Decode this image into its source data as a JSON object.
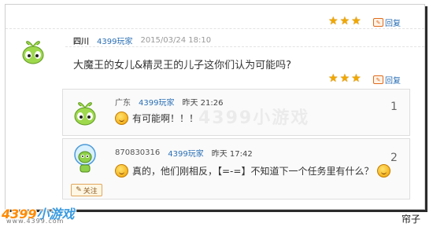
{
  "post": {
    "user": "四川",
    "source": "4399玩家",
    "time": "2015/03/24 18:10",
    "content": "大魔王的女儿&精灵王的儿子这你们认为可能吗?",
    "reply_label": "回复"
  },
  "top_reply_label": "回复",
  "replies": [
    {
      "user": "广东",
      "source": "4399玩家",
      "time": "昨天 21:26",
      "content": "有可能啊！！！",
      "floor": "1"
    },
    {
      "user": "870830316",
      "source": "4399玩家",
      "time": "昨天 17:42",
      "content_a": "真的，他们刚相反，【=-=】不知道下一个任务里有什么？",
      "follow_label": "关注",
      "floor": "2"
    }
  ],
  "watermark": "4399小游戏",
  "logo": {
    "num": "4399",
    "cn": "小游戏",
    "site": "www.4399.com"
  },
  "caption": "帘子",
  "colors": {
    "accent": "#2a6fb5",
    "star": "#f0a800",
    "logo": "#ff8a00"
  }
}
